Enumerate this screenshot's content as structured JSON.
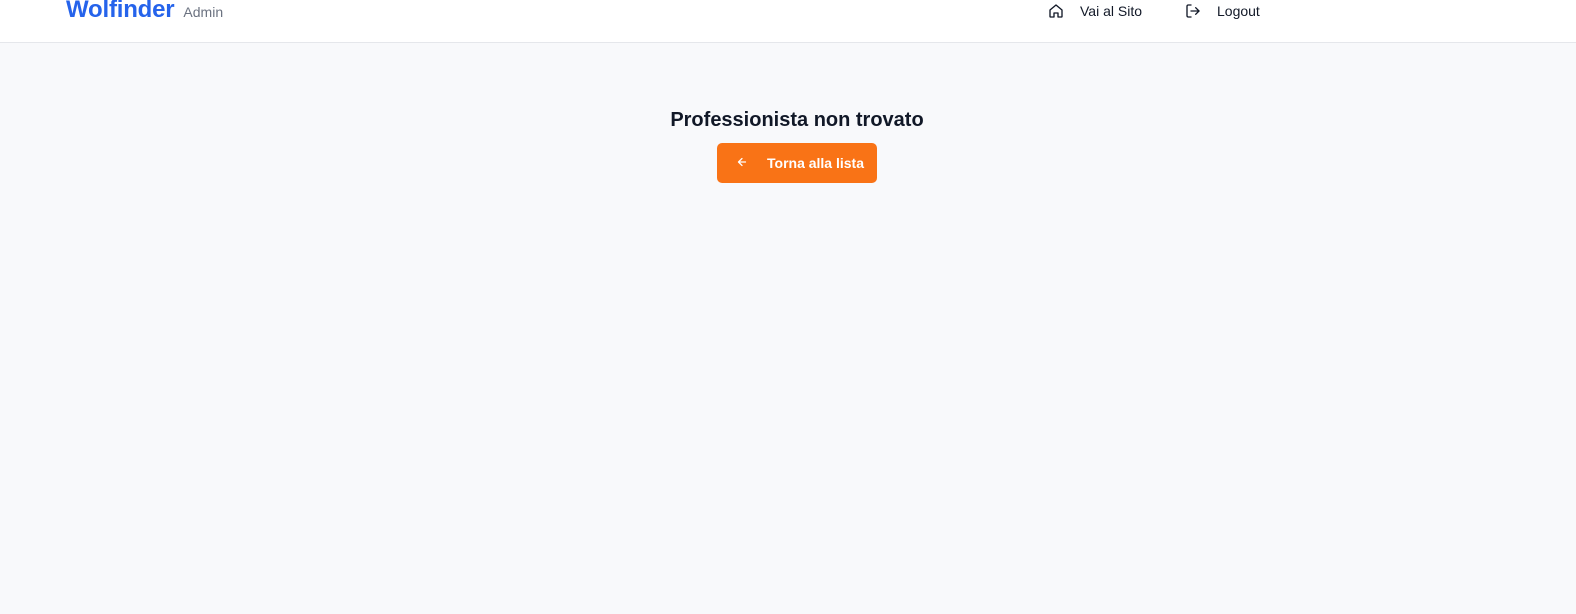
{
  "header": {
    "brand": "Wolfinder",
    "brand_sub": "Admin",
    "nav": {
      "site_label": "Vai al Sito",
      "site_icon": "home-icon",
      "logout_label": "Logout",
      "logout_icon": "logout-icon"
    }
  },
  "main": {
    "title": "Professionista non trovato",
    "back_button_label": "Torna alla lista",
    "back_button_icon": "arrow-left-icon"
  },
  "colors": {
    "brand": "#2563eb",
    "accent": "#f97316",
    "background": "#f8f9fb"
  }
}
